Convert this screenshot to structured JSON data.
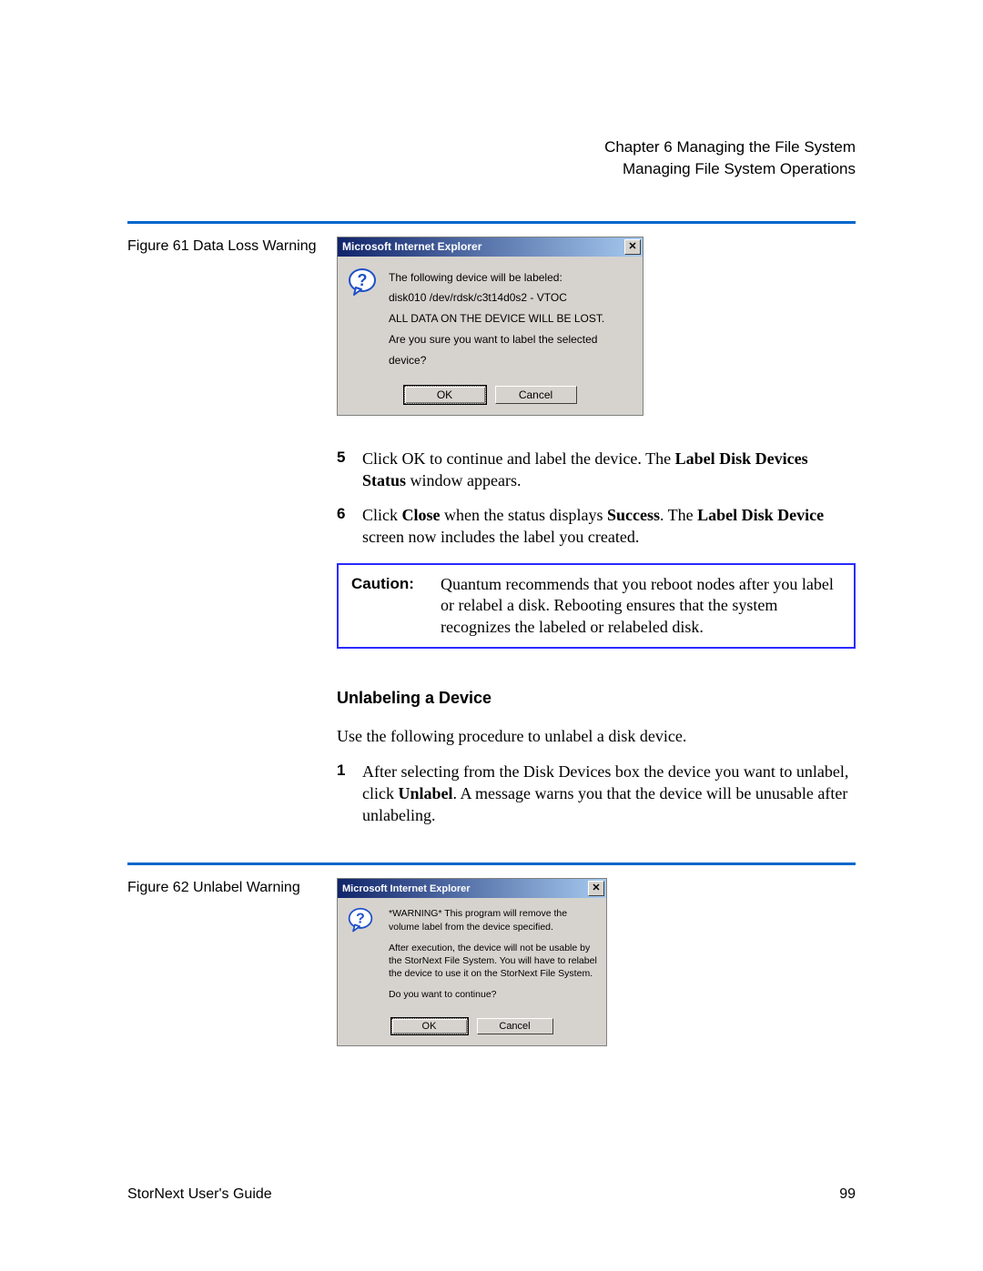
{
  "header": {
    "chapter": "Chapter 6  Managing the File System",
    "section": "Managing File System Operations"
  },
  "figure61": {
    "caption": "Figure 61  Data Loss Warning",
    "dialog": {
      "title": "Microsoft Internet Explorer",
      "line1": "The following device will be labeled:",
      "line2": "disk010 /dev/rdsk/c3t14d0s2 - VTOC",
      "line3": "ALL DATA ON THE DEVICE WILL BE LOST.",
      "line4": "Are you sure you want to label the selected device?",
      "ok": "OK",
      "cancel": "Cancel"
    }
  },
  "steps": {
    "s5_num": "5",
    "s5_a": "Click OK to continue and label the device. The ",
    "s5_b": "Label Disk Devices Status",
    "s5_c": " window appears.",
    "s6_num": "6",
    "s6_a": "Click ",
    "s6_b": "Close",
    "s6_c": " when the status displays ",
    "s6_d": "Success",
    "s6_e": ". The ",
    "s6_f": "Label Disk Device",
    "s6_g": " screen now includes the label you created."
  },
  "caution": {
    "label": "Caution:",
    "text": "Quantum recommends that you reboot nodes after you label or relabel a disk. Rebooting ensures that the system recognizes the labeled or relabeled disk."
  },
  "unlabel": {
    "heading": "Unlabeling a Device",
    "intro": "Use the following procedure to unlabel a disk device.",
    "s1_num": "1",
    "s1_a": "After selecting from the Disk Devices box the device you want to unlabel, click ",
    "s1_b": "Unlabel",
    "s1_c": ". A message warns you that the device will be unusable after unlabeling."
  },
  "figure62": {
    "caption": "Figure 62  Unlabel Warning",
    "dialog": {
      "title": "Microsoft Internet Explorer",
      "p1": "*WARNING* This program will remove the volume label from the device specified.",
      "p2": "After execution, the device will not be usable by the StorNext File System. You will have to relabel the device to use it on the StorNext File System.",
      "p3": "Do you want to continue?",
      "ok": "OK",
      "cancel": "Cancel"
    }
  },
  "footer": {
    "left": "StorNext User's Guide",
    "right": "99"
  }
}
